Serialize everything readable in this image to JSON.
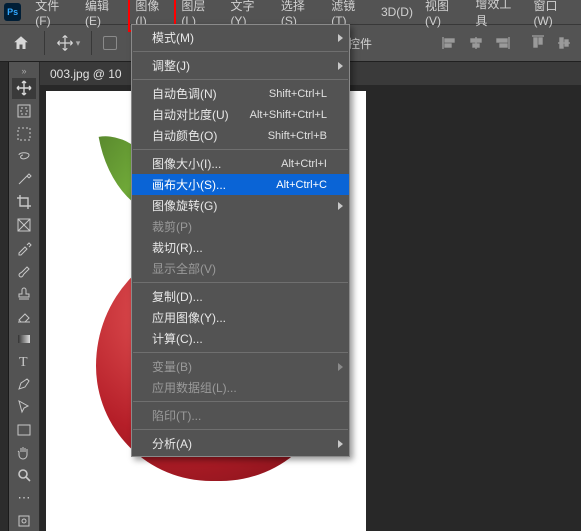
{
  "menubar": {
    "items": [
      {
        "label": "文件(F)"
      },
      {
        "label": "编辑(E)"
      },
      {
        "label": "图像(I)",
        "active": true
      },
      {
        "label": "图层(L)"
      },
      {
        "label": "文字(Y)"
      },
      {
        "label": "选择(S)"
      },
      {
        "label": "滤镜(T)"
      },
      {
        "label": "3D(D)"
      },
      {
        "label": "视图(V)"
      },
      {
        "label": "增效工具"
      },
      {
        "label": "窗口(W)"
      }
    ],
    "logo": "Ps"
  },
  "tab": {
    "label": "003.jpg @ 10"
  },
  "dropdown": {
    "groups": [
      [
        {
          "label": "模式(M)",
          "submenu": true
        }
      ],
      [
        {
          "label": "调整(J)",
          "submenu": true
        }
      ],
      [
        {
          "label": "自动色调(N)",
          "shortcut": "Shift+Ctrl+L"
        },
        {
          "label": "自动对比度(U)",
          "shortcut": "Alt+Shift+Ctrl+L"
        },
        {
          "label": "自动颜色(O)",
          "shortcut": "Shift+Ctrl+B"
        }
      ],
      [
        {
          "label": "图像大小(I)...",
          "shortcut": "Alt+Ctrl+I"
        },
        {
          "label": "画布大小(S)...",
          "shortcut": "Alt+Ctrl+C",
          "highlight": true,
          "red_frame": true
        },
        {
          "label": "图像旋转(G)",
          "submenu": true
        },
        {
          "label": "裁剪(P)",
          "disabled": true
        },
        {
          "label": "裁切(R)..."
        },
        {
          "label": "显示全部(V)",
          "disabled": true
        }
      ],
      [
        {
          "label": "复制(D)..."
        },
        {
          "label": "应用图像(Y)..."
        },
        {
          "label": "计算(C)..."
        }
      ],
      [
        {
          "label": "变量(B)",
          "submenu": true,
          "disabled": true
        },
        {
          "label": "应用数据组(L)...",
          "disabled": true
        }
      ],
      [
        {
          "label": "陷印(T)...",
          "disabled": true
        }
      ],
      [
        {
          "label": "分析(A)",
          "submenu": true
        }
      ]
    ]
  },
  "toolbar": {
    "truncated_label": "控件"
  },
  "tools": [
    "move",
    "artboard",
    "marquee",
    "lasso",
    "wand",
    "crop",
    "frame",
    "eyedropper",
    "brush",
    "stamp",
    "eraser",
    "gradient",
    "smudge",
    "dodge",
    "text",
    "pen",
    "arrow",
    "rectangle",
    "hand",
    "zoom",
    "swap",
    "ellipsis"
  ]
}
